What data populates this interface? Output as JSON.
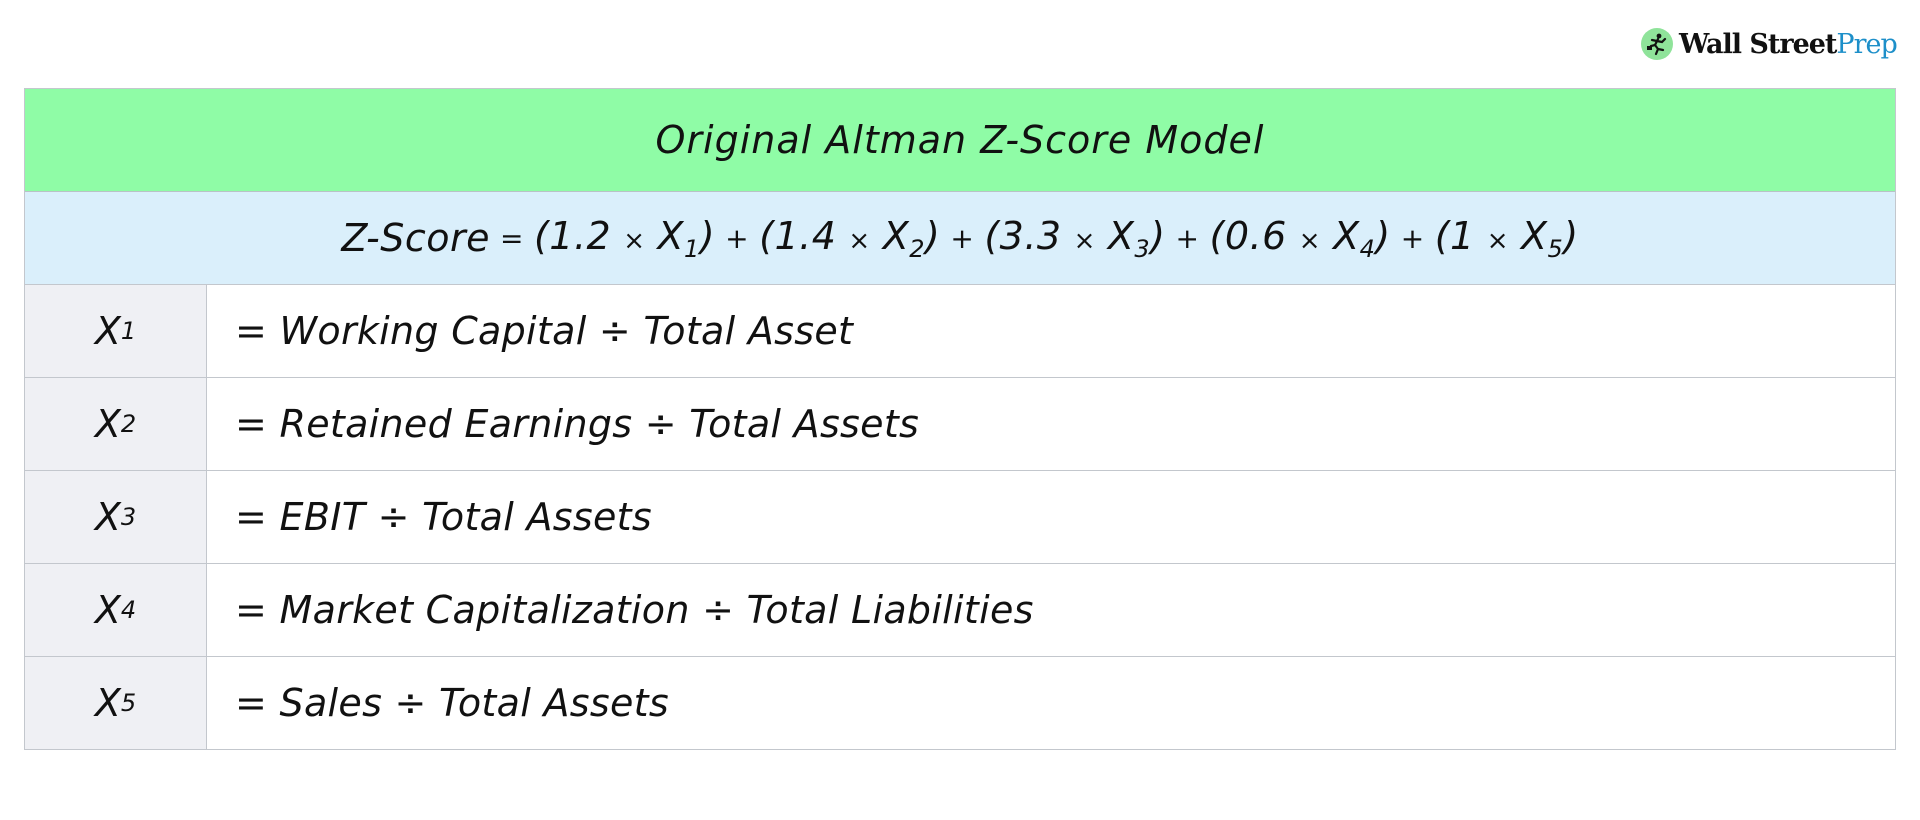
{
  "logo": {
    "brand_primary": "Wall Street",
    "brand_secondary": "Prep",
    "icon": "running-businessman-icon",
    "colors": {
      "badge": "#8fe39a",
      "primary": "#111111",
      "secondary": "#1d8fc9"
    }
  },
  "table": {
    "title": "Original Altman Z-Score Model",
    "colors": {
      "header_bg": "#8ffca6",
      "formula_bg": "#daeffb",
      "var_col_bg": "#eff0f4",
      "border": "#c3c7cd"
    },
    "formula": {
      "lhs": "Z-Score",
      "equals": "=",
      "terms": [
        {
          "coef": "1.2",
          "var": "X",
          "sub": "1"
        },
        {
          "coef": "1.4",
          "var": "X",
          "sub": "2"
        },
        {
          "coef": "3.3",
          "var": "X",
          "sub": "3"
        },
        {
          "coef": "0.6",
          "var": "X",
          "sub": "4"
        },
        {
          "coef": "1",
          "var": "X",
          "sub": "5"
        }
      ],
      "plus": "+",
      "times": "×"
    },
    "rows": [
      {
        "var": "X",
        "sub": "1",
        "definition": "= Working Capital ÷ Total Asset"
      },
      {
        "var": "X",
        "sub": "2",
        "definition": "= Retained Earnings ÷ Total Assets"
      },
      {
        "var": "X",
        "sub": "3",
        "definition": "= EBIT ÷ Total Assets"
      },
      {
        "var": "X",
        "sub": "4",
        "definition": "= Market Capitalization ÷ Total Liabilities"
      },
      {
        "var": "X",
        "sub": "5",
        "definition": "= Sales ÷ Total Assets"
      }
    ]
  }
}
